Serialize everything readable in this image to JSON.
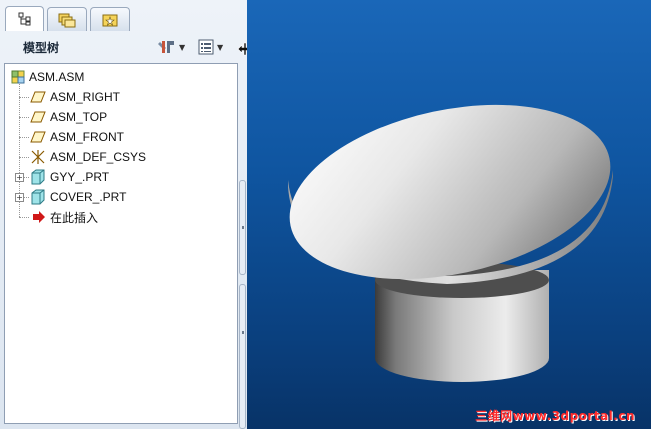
{
  "tabs": [
    {
      "icon": "model-tree-icon",
      "active": true
    },
    {
      "icon": "folder-browser-icon",
      "active": false
    },
    {
      "icon": "favorites-icon",
      "active": false
    }
  ],
  "panel": {
    "title": "模型树",
    "settings_icon": "settings-tools-icon",
    "show_icon": "show-list-icon"
  },
  "tree": {
    "items": [
      {
        "label": "ASM.ASM",
        "icon": "assembly-icon"
      },
      {
        "label": "ASM_RIGHT",
        "icon": "datum-plane-icon"
      },
      {
        "label": "ASM_TOP",
        "icon": "datum-plane-icon"
      },
      {
        "label": "ASM_FRONT",
        "icon": "datum-plane-icon"
      },
      {
        "label": "ASM_DEF_CSYS",
        "icon": "csys-icon"
      },
      {
        "label": "GYY_.PRT",
        "icon": "part-icon",
        "expandable": true
      },
      {
        "label": "COVER_.PRT",
        "icon": "part-icon",
        "expandable": true
      },
      {
        "label": "在此插入",
        "icon": "insert-here-arrow-icon"
      }
    ]
  },
  "watermark": "三维网www.3dportal.cn",
  "colors": {
    "viewport_top": "#1a67b8",
    "viewport_bottom": "#083367",
    "watermark": "#ff2a2a"
  }
}
